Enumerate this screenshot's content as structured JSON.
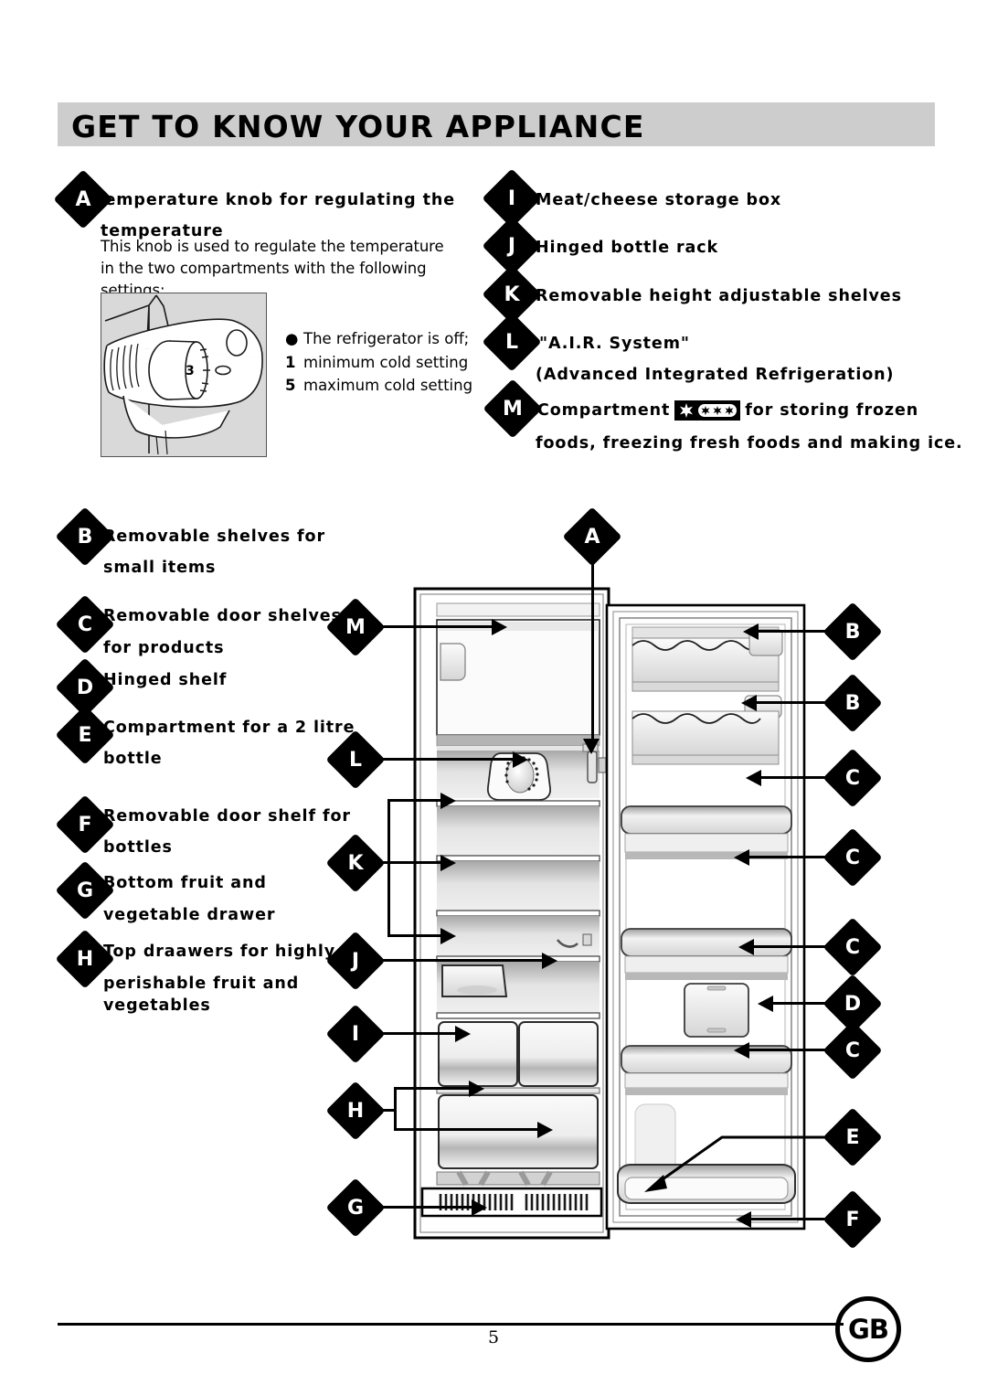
{
  "page": {
    "title": "GET TO KNOW YOUR APPLIANCE",
    "number": "5",
    "locale_badge": "GB",
    "header_bg": "#cdcdcd"
  },
  "legend_left": [
    {
      "key": "A",
      "label": "Temperature knob for regulating the",
      "label2": "temperature",
      "body": "This knob is used to regulate the temperature in the two compartments with the following settings:"
    },
    {
      "key": "B",
      "label": "Removable shelves for",
      "label2": "small items"
    },
    {
      "key": "C",
      "label": "Removable door shelves",
      "label2": "for products"
    },
    {
      "key": "D",
      "label": "Hinged shelf",
      "label2": ""
    },
    {
      "key": "E",
      "label": "Compartment for a 2 litre",
      "label2": "bottle"
    },
    {
      "key": "F",
      "label": "Removable door shelf for",
      "label2": "bottles"
    },
    {
      "key": "G",
      "label": "Bottom fruit and",
      "label2": "vegetable drawer"
    },
    {
      "key": "H",
      "label": "Top draawers for highly",
      "label2": "perishable fruit and",
      "label3": "vegetables"
    }
  ],
  "legend_right": [
    {
      "key": "I",
      "label": "Meat/cheese storage box"
    },
    {
      "key": "J",
      "label": "Hinged bottle rack"
    },
    {
      "key": "K",
      "label": "Removable height adjustable shelves"
    },
    {
      "key": "L",
      "label": "\"A.I.R. System\"",
      "label2": "(Advanced Integrated Refrigeration)"
    },
    {
      "key": "M",
      "label_pre": "Compartment",
      "symbol": "four-star-freezer-icon",
      "label_post": "for storing frozen",
      "label2": "foods, freezing fresh foods and making ice."
    }
  ],
  "knob": {
    "dial_value": "3",
    "settings": [
      {
        "mark": "●",
        "text": "The refrigerator is off;"
      },
      {
        "mark": "1",
        "text": "minimum cold setting"
      },
      {
        "mark": "5",
        "text": "maximum cold setting"
      }
    ]
  },
  "callouts_diagram": {
    "left": [
      "M",
      "L",
      "K",
      "J",
      "I",
      "H",
      "G"
    ],
    "right": [
      "A",
      "B",
      "B",
      "C",
      "C",
      "C",
      "D",
      "C",
      "E",
      "F"
    ]
  }
}
